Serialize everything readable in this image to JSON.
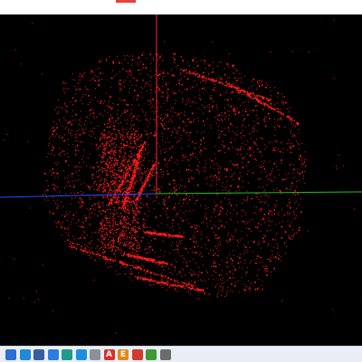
{
  "viewport": {
    "background": "#000000",
    "point_color": "#ff1a1a",
    "axes": [
      {
        "name": "x-axis",
        "color": "#22c022"
      },
      {
        "name": "y-axis",
        "color": "#ff2a2a"
      },
      {
        "name": "z-axis",
        "color": "#2a4dff"
      }
    ]
  },
  "titlebar": {
    "accent_color": "#e8433a"
  },
  "taskbar": {
    "icons": [
      {
        "name": "desktop-icon",
        "color": "#2b6fd6",
        "glyph": ""
      },
      {
        "name": "vscode-icon",
        "color": "#1f8ad6",
        "glyph": ""
      },
      {
        "name": "python-icon",
        "color": "#355f9e",
        "glyph": ""
      },
      {
        "name": "store-icon",
        "color": "#2a7de1",
        "glyph": ""
      },
      {
        "name": "teams-icon",
        "color": "#1e9b8a",
        "glyph": ""
      },
      {
        "name": "bag-icon",
        "color": "#1a8fe0",
        "glyph": ""
      },
      {
        "name": "folder-icon",
        "color": "#8c9199",
        "glyph": ""
      },
      {
        "name": "acrobat-icon",
        "color": "#d9302b",
        "glyph": "A"
      },
      {
        "name": "editor-icon",
        "color": "#e38b16",
        "glyph": "E"
      },
      {
        "name": "app-icon",
        "color": "#d23a2e",
        "glyph": ""
      },
      {
        "name": "git-icon",
        "color": "#3f9a35",
        "glyph": ""
      },
      {
        "name": "tool-icon",
        "color": "#6c6c6c",
        "glyph": ""
      }
    ]
  }
}
